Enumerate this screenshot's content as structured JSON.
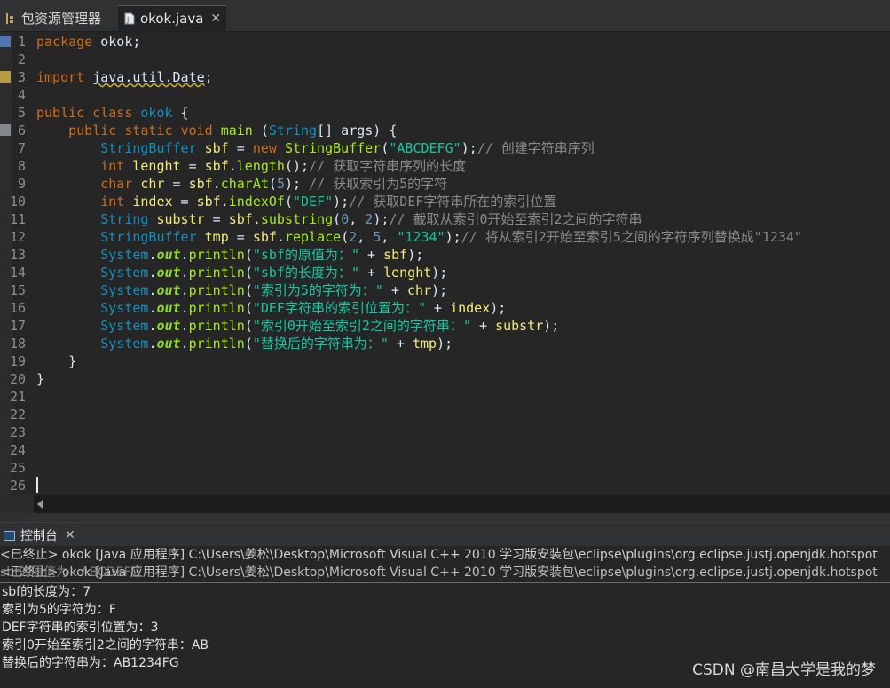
{
  "tabs": {
    "package_explorer": "包资源管理器",
    "editor_file": "okok.java",
    "close_glyph": "✕"
  },
  "code": [
    {
      "n": "1",
      "segs": [
        [
          "kw",
          "package"
        ],
        [
          "t",
          " okok;"
        ]
      ]
    },
    {
      "n": "2",
      "segs": []
    },
    {
      "n": "3",
      "segs": [
        [
          "kw",
          "import"
        ],
        [
          "t",
          " "
        ],
        [
          "und",
          "java.util.Date"
        ],
        [
          "t",
          ";"
        ]
      ]
    },
    {
      "n": "4",
      "segs": []
    },
    {
      "n": "5",
      "segs": [
        [
          "kw",
          "public"
        ],
        [
          "t",
          " "
        ],
        [
          "kw",
          "class"
        ],
        [
          "t",
          " "
        ],
        [
          "cls",
          "okok"
        ],
        [
          "t",
          " {"
        ]
      ]
    },
    {
      "n": "6",
      "segs": [
        [
          "t",
          "    "
        ],
        [
          "kw",
          "public"
        ],
        [
          "t",
          " "
        ],
        [
          "kw",
          "static"
        ],
        [
          "t",
          " "
        ],
        [
          "kw",
          "void"
        ],
        [
          "t",
          " "
        ],
        [
          "meth",
          "main"
        ],
        [
          "t",
          " ("
        ],
        [
          "cls",
          "String"
        ],
        [
          "t",
          "[] args) {"
        ]
      ]
    },
    {
      "n": "7",
      "segs": [
        [
          "t",
          "        "
        ],
        [
          "cls",
          "StringBuffer"
        ],
        [
          "t",
          " "
        ],
        [
          "var",
          "sbf"
        ],
        [
          "t",
          " = "
        ],
        [
          "kw",
          "new"
        ],
        [
          "t",
          " "
        ],
        [
          "meth",
          "StringBuffer"
        ],
        [
          "t",
          "("
        ],
        [
          "str",
          "\"ABCDEFG\""
        ],
        [
          "t",
          ");"
        ],
        [
          "cmt",
          "// 创建字符串序列"
        ]
      ]
    },
    {
      "n": "8",
      "segs": [
        [
          "t",
          "        "
        ],
        [
          "kw",
          "int"
        ],
        [
          "t",
          " "
        ],
        [
          "var",
          "lenght"
        ],
        [
          "t",
          " = "
        ],
        [
          "var",
          "sbf"
        ],
        [
          "t",
          "."
        ],
        [
          "meth",
          "length"
        ],
        [
          "t",
          "();"
        ],
        [
          "cmt",
          "// 获取字符串序列的长度"
        ]
      ]
    },
    {
      "n": "9",
      "segs": [
        [
          "t",
          "        "
        ],
        [
          "kw",
          "char"
        ],
        [
          "t",
          " "
        ],
        [
          "var",
          "chr"
        ],
        [
          "t",
          " = "
        ],
        [
          "var",
          "sbf"
        ],
        [
          "t",
          "."
        ],
        [
          "meth",
          "charAt"
        ],
        [
          "t",
          "("
        ],
        [
          "num",
          "5"
        ],
        [
          "t",
          "); "
        ],
        [
          "cmt",
          "// 获取索引为5的字符"
        ]
      ]
    },
    {
      "n": "10",
      "segs": [
        [
          "t",
          "        "
        ],
        [
          "kw",
          "int"
        ],
        [
          "t",
          " "
        ],
        [
          "var",
          "index"
        ],
        [
          "t",
          " = "
        ],
        [
          "var",
          "sbf"
        ],
        [
          "t",
          "."
        ],
        [
          "meth",
          "indexOf"
        ],
        [
          "t",
          "("
        ],
        [
          "str",
          "\"DEF\""
        ],
        [
          "t",
          ");"
        ],
        [
          "cmt",
          "// 获取DEF字符串所在的索引位置"
        ]
      ]
    },
    {
      "n": "11",
      "segs": [
        [
          "t",
          "        "
        ],
        [
          "cls",
          "String"
        ],
        [
          "t",
          " "
        ],
        [
          "var",
          "substr"
        ],
        [
          "t",
          " = "
        ],
        [
          "var",
          "sbf"
        ],
        [
          "t",
          "."
        ],
        [
          "meth",
          "substring"
        ],
        [
          "t",
          "("
        ],
        [
          "num",
          "0"
        ],
        [
          "t",
          ", "
        ],
        [
          "num",
          "2"
        ],
        [
          "t",
          ");"
        ],
        [
          "cmt",
          "// 截取从索引0开始至索引2之间的字符串"
        ]
      ]
    },
    {
      "n": "12",
      "segs": [
        [
          "t",
          "        "
        ],
        [
          "cls",
          "StringBuffer"
        ],
        [
          "t",
          " "
        ],
        [
          "var",
          "tmp"
        ],
        [
          "t",
          " = "
        ],
        [
          "var",
          "sbf"
        ],
        [
          "t",
          "."
        ],
        [
          "meth",
          "replace"
        ],
        [
          "t",
          "("
        ],
        [
          "num",
          "2"
        ],
        [
          "t",
          ", "
        ],
        [
          "num",
          "5"
        ],
        [
          "t",
          ", "
        ],
        [
          "str",
          "\"1234\""
        ],
        [
          "t",
          ");"
        ],
        [
          "cmt",
          "// 将从索引2开始至索引5之间的字符序列替换成\"1234\""
        ]
      ]
    },
    {
      "n": "13",
      "segs": [
        [
          "t",
          "        "
        ],
        [
          "cls",
          "System"
        ],
        [
          "t",
          "."
        ],
        [
          "fld",
          "out"
        ],
        [
          "t",
          "."
        ],
        [
          "meth",
          "println"
        ],
        [
          "t",
          "("
        ],
        [
          "str",
          "\"sbf的原值为：\""
        ],
        [
          "t",
          " + "
        ],
        [
          "var",
          "sbf"
        ],
        [
          "t",
          ");"
        ]
      ]
    },
    {
      "n": "14",
      "segs": [
        [
          "t",
          "        "
        ],
        [
          "cls",
          "System"
        ],
        [
          "t",
          "."
        ],
        [
          "fld",
          "out"
        ],
        [
          "t",
          "."
        ],
        [
          "meth",
          "println"
        ],
        [
          "t",
          "("
        ],
        [
          "str",
          "\"sbf的长度为：\""
        ],
        [
          "t",
          " + "
        ],
        [
          "var",
          "lenght"
        ],
        [
          "t",
          ");"
        ]
      ]
    },
    {
      "n": "15",
      "segs": [
        [
          "t",
          "        "
        ],
        [
          "cls",
          "System"
        ],
        [
          "t",
          "."
        ],
        [
          "fld",
          "out"
        ],
        [
          "t",
          "."
        ],
        [
          "meth",
          "println"
        ],
        [
          "t",
          "("
        ],
        [
          "str",
          "\"索引为5的字符为：\""
        ],
        [
          "t",
          " + "
        ],
        [
          "var",
          "chr"
        ],
        [
          "t",
          ");"
        ]
      ]
    },
    {
      "n": "16",
      "segs": [
        [
          "t",
          "        "
        ],
        [
          "cls",
          "System"
        ],
        [
          "t",
          "."
        ],
        [
          "fld",
          "out"
        ],
        [
          "t",
          "."
        ],
        [
          "meth",
          "println"
        ],
        [
          "t",
          "("
        ],
        [
          "str",
          "\"DEF字符串的索引位置为：\""
        ],
        [
          "t",
          " + "
        ],
        [
          "var",
          "index"
        ],
        [
          "t",
          ");"
        ]
      ]
    },
    {
      "n": "17",
      "segs": [
        [
          "t",
          "        "
        ],
        [
          "cls",
          "System"
        ],
        [
          "t",
          "."
        ],
        [
          "fld",
          "out"
        ],
        [
          "t",
          "."
        ],
        [
          "meth",
          "println"
        ],
        [
          "t",
          "("
        ],
        [
          "str",
          "\"索引0开始至索引2之间的字符串：\""
        ],
        [
          "t",
          " + "
        ],
        [
          "var",
          "substr"
        ],
        [
          "t",
          ");"
        ]
      ]
    },
    {
      "n": "18",
      "segs": [
        [
          "t",
          "        "
        ],
        [
          "cls",
          "System"
        ],
        [
          "t",
          "."
        ],
        [
          "fld",
          "out"
        ],
        [
          "t",
          "."
        ],
        [
          "meth",
          "println"
        ],
        [
          "t",
          "("
        ],
        [
          "str",
          "\"替换后的字符串为：\""
        ],
        [
          "t",
          " + "
        ],
        [
          "var",
          "tmp"
        ],
        [
          "t",
          ");"
        ]
      ]
    },
    {
      "n": "19",
      "segs": [
        [
          "t",
          "    }"
        ]
      ]
    },
    {
      "n": "20",
      "segs": [
        [
          "t",
          "}"
        ]
      ]
    },
    {
      "n": "21",
      "segs": []
    },
    {
      "n": "22",
      "segs": []
    },
    {
      "n": "23",
      "segs": []
    },
    {
      "n": "24",
      "segs": []
    },
    {
      "n": "25",
      "segs": []
    },
    {
      "n": "26",
      "segs": []
    }
  ],
  "console": {
    "tab_label": "控制台",
    "close_glyph": "✕",
    "status_line": "<已终止> okok [Java 应用程序] C:\\Users\\姜松\\Desktop\\Microsoft Visual C++ 2010 学习版安装包\\eclipse\\plugins\\org.eclipse.justj.openjdk.hotspot",
    "status_line_repeat": "<已终止> okok [Java 应用程序] C:\\Users\\姜松\\Desktop\\Microsoft Visual C++ 2010 学习版安装包\\eclipse\\plugins\\org.eclipse.justj.openjdk.hotspot",
    "status_ghost": "sbf的原值为：ABCDEFG",
    "output": [
      "sbf的长度为：7",
      "索引为5的字符为：F",
      "DEF字符串的索引位置为：3",
      "索引0开始至索引2之间的字符串：AB",
      "替换后的字符串为：AB1234FG"
    ]
  },
  "watermark": "CSDN @南昌大学是我的梦"
}
